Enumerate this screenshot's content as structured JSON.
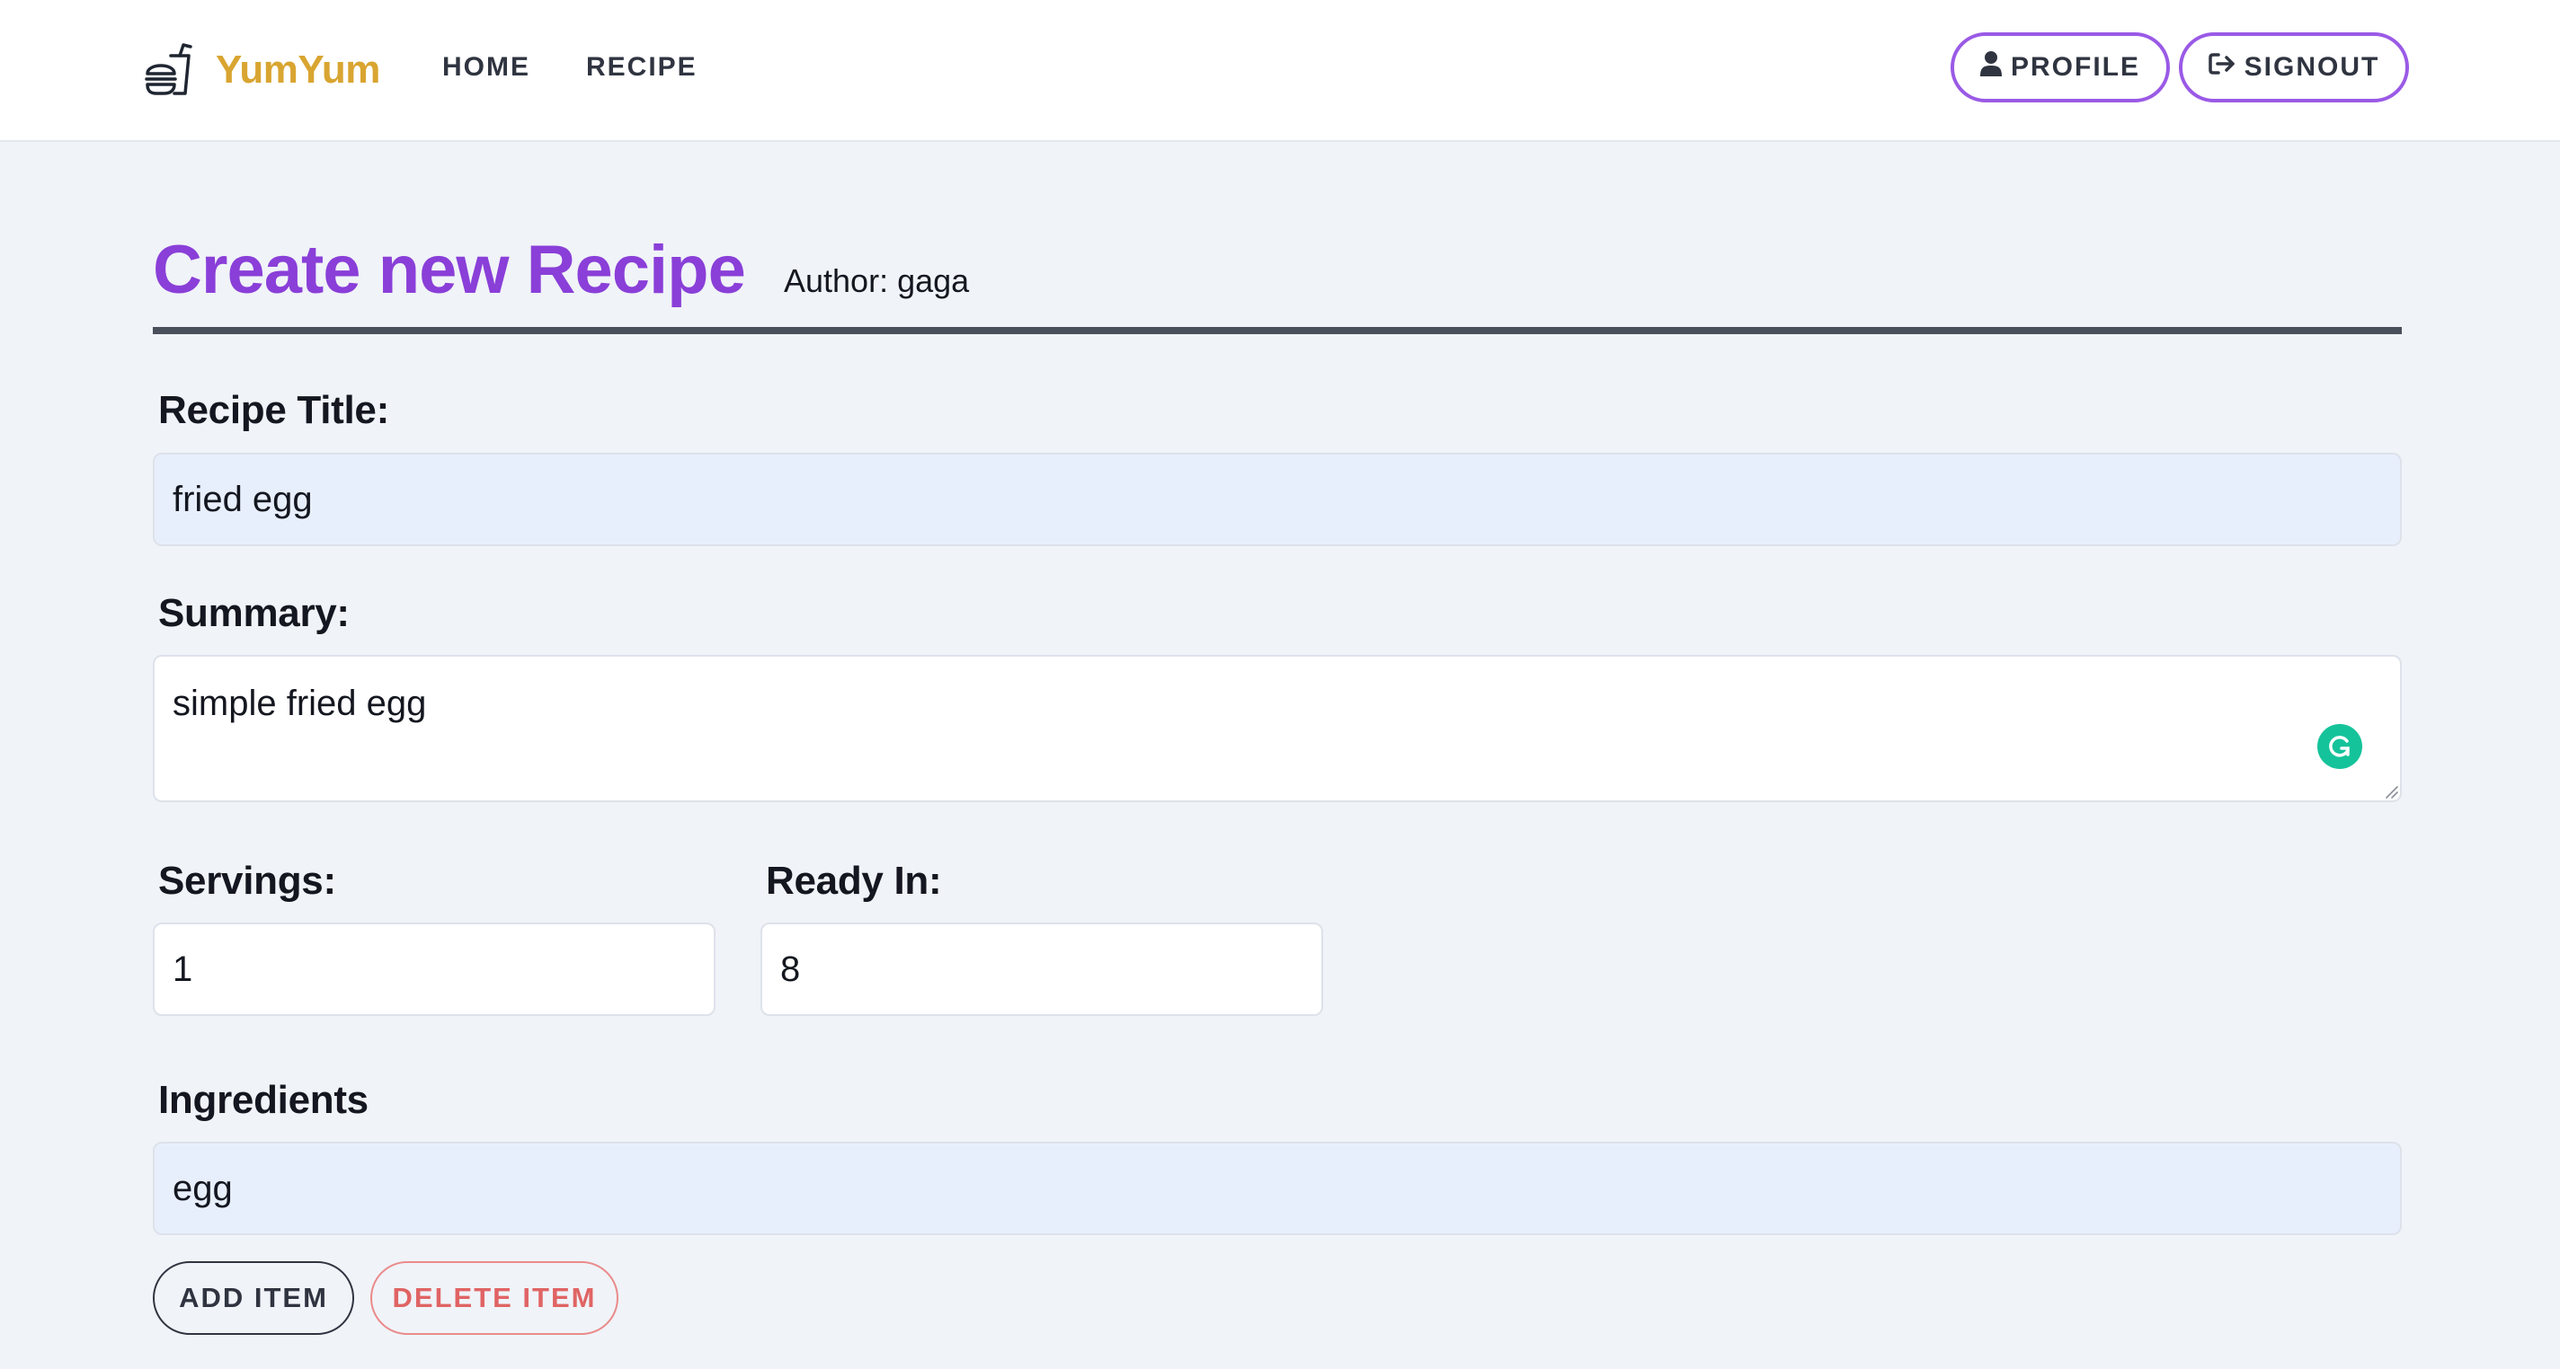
{
  "navbar": {
    "brand": "YumYum",
    "links": [
      "HOME",
      "RECIPE"
    ],
    "profile_label": "PROFILE",
    "signout_label": "SIGNOUT",
    "brand_color": "#d9a531",
    "accent_color": "#9a5ae6"
  },
  "header": {
    "title": "Create new Recipe",
    "author": "Author: gaga",
    "title_color": "#8a3fd8"
  },
  "form": {
    "title_label": "Recipe Title:",
    "title_value": "fried egg",
    "summary_label": "Summary:",
    "summary_value": "simple fried egg",
    "servings_label": "Servings:",
    "servings_value": "1",
    "ready_label": "Ready In:",
    "ready_value": "8",
    "ingredients_label": "Ingredients",
    "ingredients": [
      "egg"
    ],
    "add_item_label": "ADD ITEM",
    "delete_item_label": "DELETE ITEM"
  },
  "icons": {
    "brand": "fast-food-icon",
    "profile": "user-icon",
    "signout": "sign-out-icon",
    "grammarly": "grammarly-icon",
    "resize": "resize-handle-icon"
  }
}
